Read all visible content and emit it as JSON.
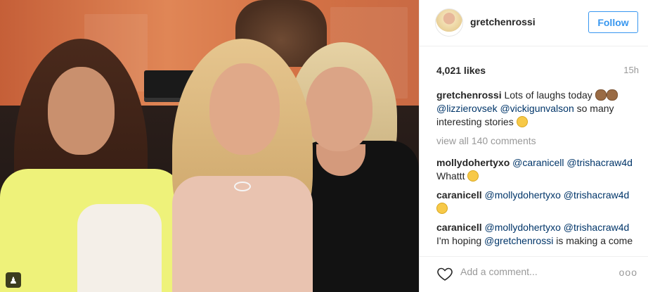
{
  "post": {
    "author": "gretchenrossi",
    "follow_label": "Follow",
    "likes": "4,021 likes",
    "time_ago": "15h",
    "caption": {
      "user": "gretchenrossi",
      "text_1": "Lots of laughs today",
      "mention_1": "@lizzierovsek",
      "mention_2": "@vickigunvalson",
      "text_2": "so many interesting stories"
    },
    "view_all": "view all 140 comments",
    "comments": [
      {
        "user": "mollydohertyxo",
        "mention_1": "@caranicell",
        "mention_2": "@trishacraw4d",
        "text": "Whattt"
      },
      {
        "user": "caranicell",
        "mention_1": "@mollydohertyxo",
        "mention_2": "@trishacraw4d",
        "text": ""
      },
      {
        "user": "caranicell",
        "mention_1": "@mollydohertyxo",
        "mention_2": "@trishacraw4d",
        "text": "I'm hoping",
        "mention_3": "@gretchenrossi",
        "text_2": "is making a come"
      }
    ],
    "add_comment_placeholder": "Add a comment...",
    "more_label": "ooo"
  },
  "icons": {
    "tag": "person-tag-icon",
    "heart": "heart-outline-icon",
    "more": "more-options-icon"
  },
  "colors": {
    "follow_blue": "#3897f0",
    "mention_blue": "#003569",
    "muted": "#999999"
  }
}
